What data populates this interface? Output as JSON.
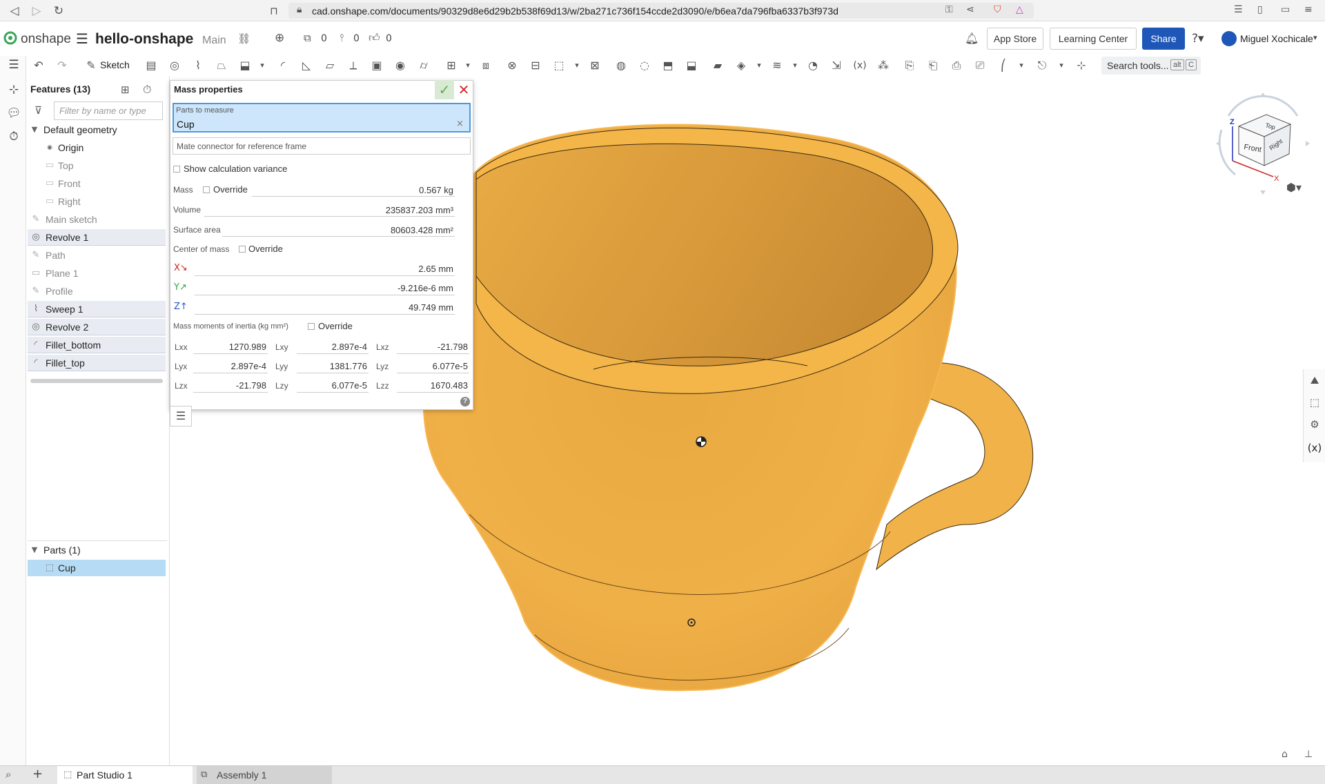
{
  "browser": {
    "url": "cad.onshape.com/documents/90329d8e6d29b2b538f69d13/w/2ba271c736f154ccde2d3090/e/b6ea7da796fba6337b3f973d"
  },
  "app": {
    "logo_text": "onshape",
    "doc_title": "hello-onshape",
    "branch": "Main",
    "versions_count": "0",
    "branches_count": "0",
    "likes_count": "0",
    "app_store": "App Store",
    "learning_center": "Learning Center",
    "share": "Share",
    "user_name": "Miguel Xochicale",
    "accent": "#1e57b8"
  },
  "toolbar": {
    "sketch_label": "Sketch",
    "search_label": "Search tools...",
    "kbd_alt": "alt",
    "kbd_c": "C"
  },
  "features": {
    "title": "Features (13)",
    "filter_placeholder": "Filter by name or type",
    "default_geometry": "Default geometry",
    "items": [
      {
        "label": "Origin",
        "icon": "origin-icon"
      },
      {
        "label": "Top",
        "icon": "plane-icon"
      },
      {
        "label": "Front",
        "icon": "plane-icon"
      },
      {
        "label": "Right",
        "icon": "plane-icon"
      },
      {
        "label": "Main sketch",
        "icon": "sketch-icon"
      },
      {
        "label": "Revolve 1",
        "icon": "revolve-icon"
      },
      {
        "label": "Path",
        "icon": "sketch-icon"
      },
      {
        "label": "Plane 1",
        "icon": "plane-icon"
      },
      {
        "label": "Profile",
        "icon": "sketch-icon"
      },
      {
        "label": "Sweep 1",
        "icon": "sweep-icon"
      },
      {
        "label": "Revolve 2",
        "icon": "revolve-icon"
      },
      {
        "label": "Fillet_bottom",
        "icon": "fillet-icon"
      },
      {
        "label": "Fillet_top",
        "icon": "fillet-icon"
      }
    ],
    "parts_header": "Parts (1)",
    "part": "Cup"
  },
  "mass_properties": {
    "title": "Mass properties",
    "parts_label": "Parts to measure",
    "parts_value": "Cup",
    "mate_placeholder": "Mate connector for reference frame",
    "show_variance": "Show calculation variance",
    "mass_label": "Mass",
    "override": "Override",
    "mass_value": "0.567 kg",
    "volume_label": "Volume",
    "volume_value": "235837.203 mm³",
    "surface_label": "Surface area",
    "surface_value": "80603.428 mm²",
    "com_label": "Center of mass",
    "com_x": "2.65 mm",
    "com_y": "-9.216e-6 mm",
    "com_z": "49.749 mm",
    "moi_label": "Mass moments of inertia (kg mm²)",
    "moi": [
      [
        {
          "k": "Lxx",
          "v": "1270.989"
        },
        {
          "k": "Lxy",
          "v": "2.897e-4"
        },
        {
          "k": "Lxz",
          "v": "-21.798"
        }
      ],
      [
        {
          "k": "Lyx",
          "v": "2.897e-4"
        },
        {
          "k": "Lyy",
          "v": "1381.776"
        },
        {
          "k": "Lyz",
          "v": "6.077e-5"
        }
      ],
      [
        {
          "k": "Lzx",
          "v": "-21.798"
        },
        {
          "k": "Lzy",
          "v": "6.077e-5"
        },
        {
          "k": "Lzz",
          "v": "1670.483"
        }
      ]
    ]
  },
  "viewcube": {
    "top": "Top",
    "front": "Front",
    "right": "Right",
    "axis_x": "X",
    "axis_z": "Z"
  },
  "tabs": {
    "part_studio": "Part Studio 1",
    "assembly": "Assembly 1"
  },
  "colors": {
    "cup": "#f2b24a",
    "selection": "#cde6fb"
  }
}
